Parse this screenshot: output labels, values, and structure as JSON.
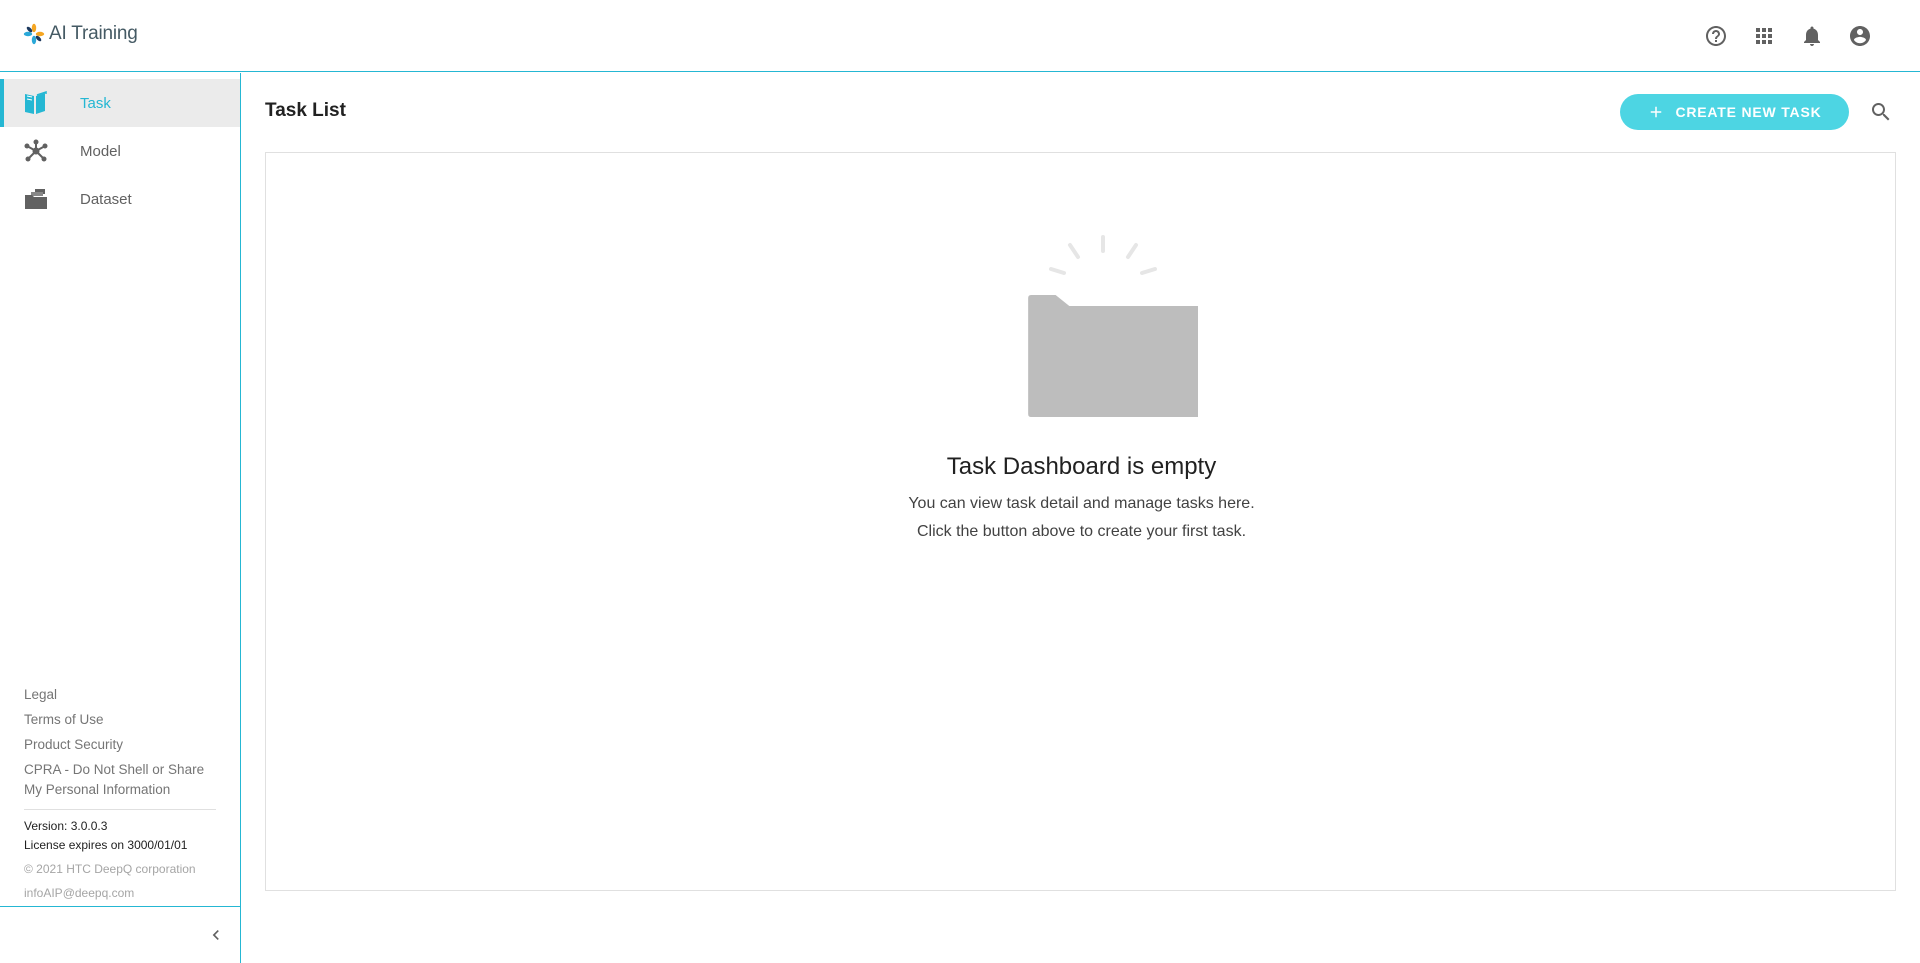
{
  "app": {
    "title": "AI Training",
    "brand_colors": {
      "accent": "#25b7d3",
      "button": "#4dd5e3",
      "icon": "#616161"
    }
  },
  "header": {
    "icons": [
      "help-icon",
      "apps-grid-icon",
      "notifications-bell-icon",
      "account-circle-icon"
    ]
  },
  "sidebar": {
    "items": [
      {
        "label": "Task",
        "icon": "task-book-icon",
        "active": true
      },
      {
        "label": "Model",
        "icon": "model-network-icon",
        "active": false
      },
      {
        "label": "Dataset",
        "icon": "dataset-folder-icon",
        "active": false
      }
    ],
    "footer_links": [
      "Legal",
      "Terms of Use",
      "Product Security",
      "CPRA - Do Not Shell or Share My Personal Information"
    ],
    "version": "Version: 3.0.0.3",
    "license": "License expires on 3000/01/01",
    "copyright": "© 2021 HTC DeepQ corporation",
    "email": "infoAIP@deepq.com"
  },
  "main": {
    "title": "Task List",
    "create_button_label": "CREATE NEW TASK",
    "empty_state": {
      "title": "Task Dashboard is empty",
      "line1": "You can view task detail and manage tasks here.",
      "line2": "Click the button above to create your first task."
    }
  }
}
